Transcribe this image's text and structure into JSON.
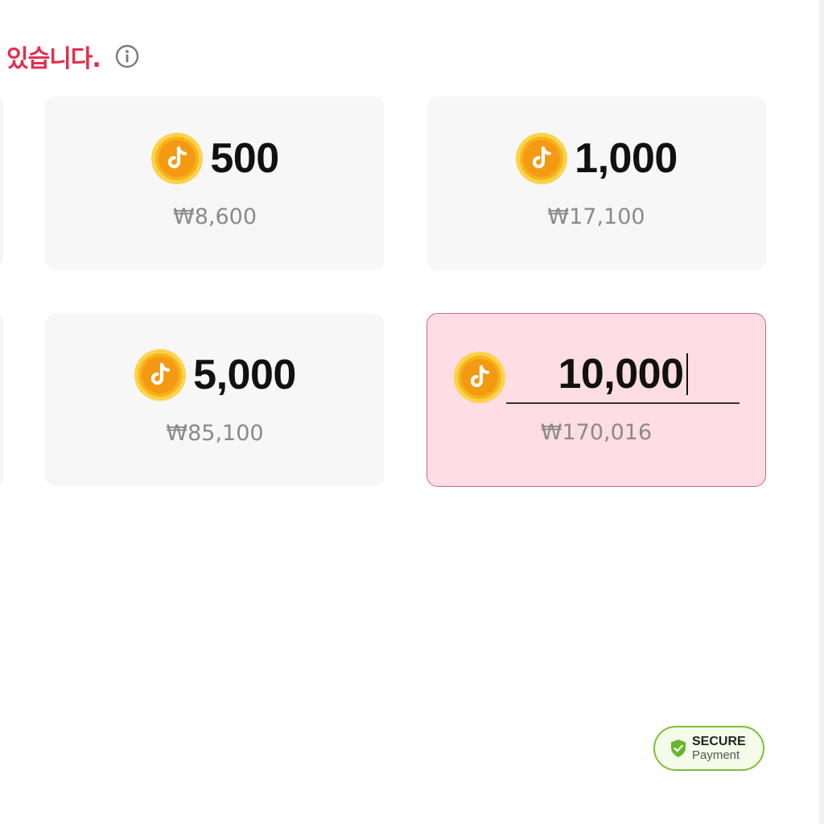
{
  "header": {
    "title": "있습니다.",
    "info_icon": "info-circle-icon"
  },
  "coin_icon": "tiktok-coin-icon",
  "packages": [
    {
      "coins": "500",
      "price": "₩8,600"
    },
    {
      "coins": "1,000",
      "price": "₩17,100"
    },
    {
      "coins": "5,000",
      "price": "₩85,100"
    }
  ],
  "custom": {
    "value": "10,000",
    "price": "₩170,016",
    "selected": true
  },
  "badge": {
    "title": "SECURE",
    "subtitle": "Payment",
    "icon": "shield-check-icon"
  },
  "colors": {
    "accent": "#e0304e",
    "selected_bg": "#ffdde4",
    "selected_border": "#c96a82",
    "card_bg": "#f7f7f7",
    "coin": "#f5a623",
    "badge_border": "#7cbf3a"
  }
}
